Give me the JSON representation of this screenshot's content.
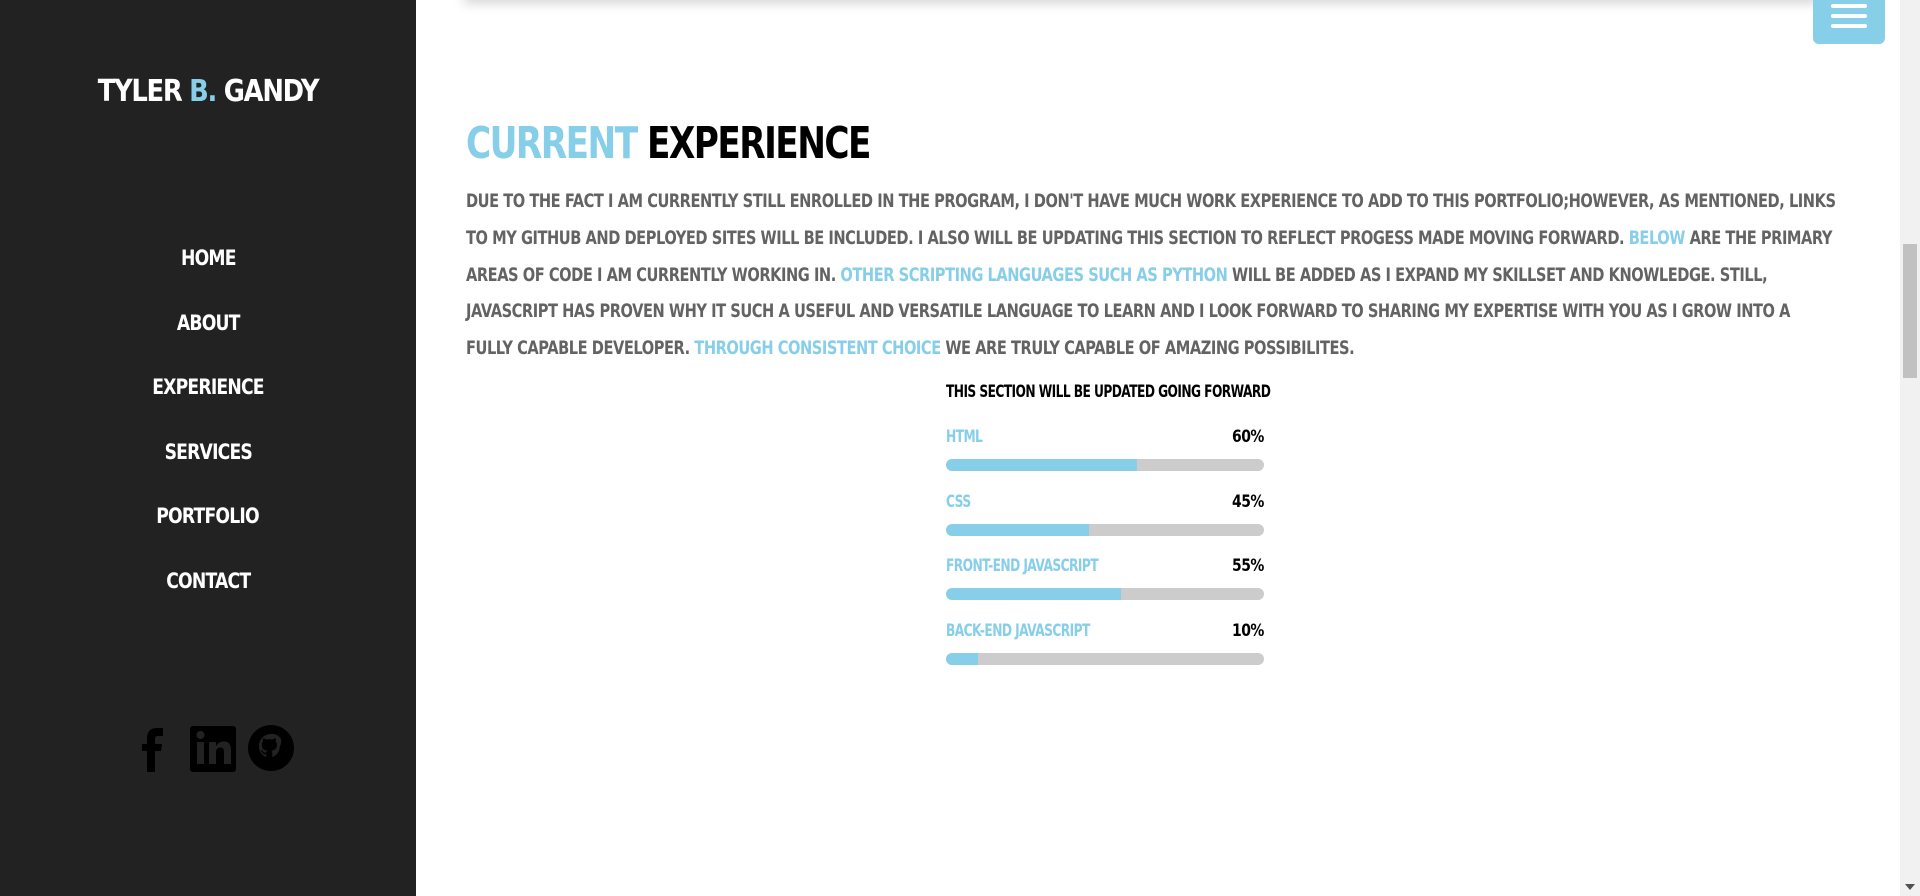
{
  "brand": {
    "first": "Tyler",
    "middle": "B.",
    "last": "Gandy"
  },
  "nav": {
    "items": [
      {
        "label": "Home"
      },
      {
        "label": "About"
      },
      {
        "label": "Experience"
      },
      {
        "label": "Services"
      },
      {
        "label": "Portfolio"
      },
      {
        "label": "Contact"
      }
    ]
  },
  "socials": [
    {
      "icon": "facebook-icon"
    },
    {
      "icon": "linkedin-icon"
    },
    {
      "icon": "github-icon"
    }
  ],
  "menu_button": {
    "icon": "hamburger-menu-icon"
  },
  "section": {
    "title_accent": "Current",
    "title_rest": "Experience",
    "paragraph": {
      "part1": "Due to the fact I am currently still enrolled in the program, I don't have much work experience to add to this portfolio;however, as mentioned, links to my GitHub and deployed sites will be included. I also will be updating this section to reflect progess made moving forward. ",
      "hl1": "Below",
      "part2": " are the primary areas of code I am currently working in. ",
      "hl2": "Other scripting languages such as Python",
      "part3": " will be added as I expand my skillset and knowledge. Still, JavaScript has proven why it such a useful and versatile language to learn and I look forward to sharing my expertise with you as I grow into a fully capable developer. ",
      "hl3": "Through consistent choice",
      "part4": " we are truly capable of amazing possibilites."
    }
  },
  "skills": {
    "heading": "This section will be updated going forward",
    "items": [
      {
        "name": "HTML",
        "percent_label": "60%",
        "percent": 60
      },
      {
        "name": "CSS",
        "percent_label": "45%",
        "percent": 45
      },
      {
        "name": "Front-End JavaScript",
        "percent_label": "55%",
        "percent": 55
      },
      {
        "name": "Back-End JavaScript",
        "percent_label": "10%",
        "percent": 10
      }
    ]
  },
  "colors": {
    "accent": "#87cee9",
    "sidebar_bg": "#222222",
    "text_gray": "#636363",
    "track": "#cccccc"
  }
}
